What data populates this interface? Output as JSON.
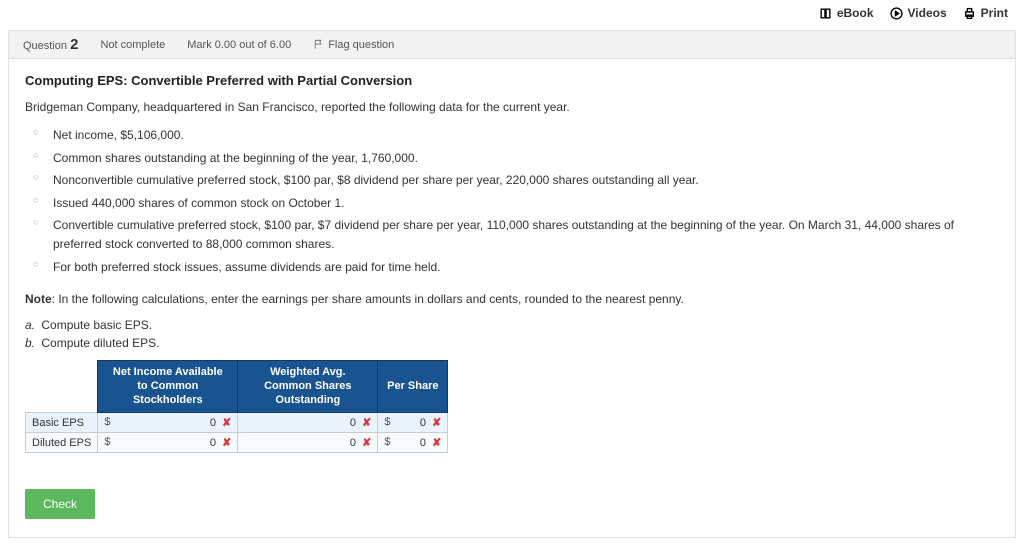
{
  "topbar": {
    "ebook": "eBook",
    "videos": "Videos",
    "print": "Print"
  },
  "qheader": {
    "question_label": "Question",
    "question_num": "2",
    "status": "Not complete",
    "mark": "Mark 0.00 out of 6.00",
    "flag": "Flag question"
  },
  "title": "Computing EPS: Convertible Preferred with Partial Conversion",
  "intro": "Bridgeman Company, headquartered in San Francisco, reported the following data for the current year.",
  "bullets": [
    "Net income, $5,106,000.",
    "Common shares outstanding at the beginning of the year, 1,760,000.",
    "Nonconvertible cumulative preferred stock, $100 par, $8 dividend per share per year, 220,000 shares outstanding all year.",
    "Issued 440,000 shares of common stock on October 1.",
    "Convertible cumulative preferred stock, $100 par, $7 dividend per share per year, 110,000 shares outstanding at the beginning of the year. On March 31, 44,000 shares of preferred stock converted to 88,000 common shares.",
    "For both preferred stock issues, assume dividends are paid for time held."
  ],
  "note_label": "Note",
  "note_text": ": In the following calculations, enter the earnings per share amounts in dollars and cents, rounded to the nearest penny.",
  "tasks": {
    "a_label": "a.",
    "a_text": "Compute basic EPS.",
    "b_label": "b.",
    "b_text": "Compute diluted EPS."
  },
  "table": {
    "h1": "Net Income Available to Common Stockholders",
    "h2": "Weighted Avg. Common Shares Outstanding",
    "h3": "Per Share",
    "rows": [
      {
        "label": "Basic EPS",
        "v1": "0",
        "v2": "0",
        "v3": "0"
      },
      {
        "label": "Diluted EPS",
        "v1": "0",
        "v2": "0",
        "v3": "0"
      }
    ]
  },
  "check": "Check"
}
